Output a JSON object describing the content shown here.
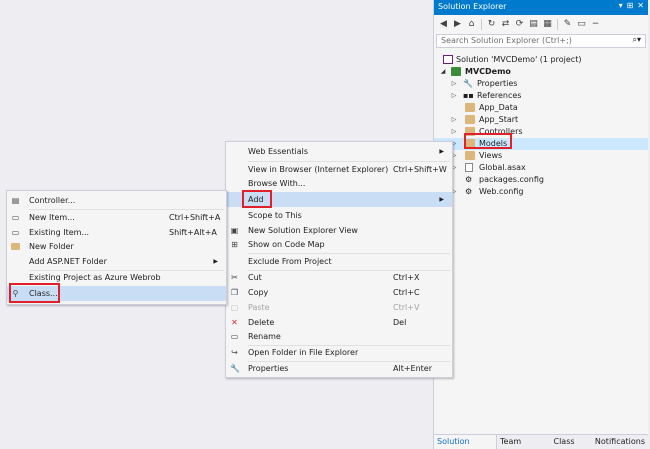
{
  "solution_explorer": {
    "title": "Solution Explorer",
    "title_buttons": [
      "▾",
      "⊞",
      "✕"
    ],
    "search_placeholder": "Search Solution Explorer (Ctrl+;)",
    "tree": [
      {
        "label": "Solution 'MVCDemo' (1 project)",
        "icon": "solution-icon"
      },
      {
        "label": "MVCDemo",
        "icon": "project-icon",
        "bold": true
      },
      {
        "label": "Properties",
        "icon": "wrench-icon"
      },
      {
        "label": "References",
        "icon": "references-icon"
      },
      {
        "label": "App_Data",
        "icon": "folder-icon"
      },
      {
        "label": "App_Start",
        "icon": "folder-icon"
      },
      {
        "label": "Controllers",
        "icon": "folder-icon"
      },
      {
        "label": "Models",
        "icon": "folder-icon"
      },
      {
        "label": "Views",
        "icon": "folder-icon"
      },
      {
        "label": "Global.asax",
        "icon": "file-icon"
      },
      {
        "label": "packages.config",
        "icon": "config-icon"
      },
      {
        "label": "Web.config",
        "icon": "config-icon"
      }
    ],
    "tabs": [
      "Solution Explor...",
      "Team Explorer",
      "Class View",
      "Notifications"
    ]
  },
  "context_menu": {
    "items": [
      {
        "label": "Web Essentials",
        "shortcut": "",
        "submenu": true
      },
      {
        "label": "View in Browser (Internet Explorer)",
        "shortcut": "Ctrl+Shift+W"
      },
      {
        "label": "Browse With...",
        "shortcut": ""
      },
      {
        "label": "Add",
        "shortcut": "",
        "submenu": true
      },
      {
        "label": "Scope to This",
        "shortcut": ""
      },
      {
        "label": "New Solution Explorer View",
        "shortcut": ""
      },
      {
        "label": "Show on Code Map",
        "shortcut": ""
      },
      {
        "label": "Exclude From Project",
        "shortcut": ""
      },
      {
        "label": "Cut",
        "shortcut": "Ctrl+X"
      },
      {
        "label": "Copy",
        "shortcut": "Ctrl+C"
      },
      {
        "label": "Paste",
        "shortcut": "Ctrl+V"
      },
      {
        "label": "Delete",
        "shortcut": "Del"
      },
      {
        "label": "Rename",
        "shortcut": ""
      },
      {
        "label": "Open Folder in File Explorer",
        "shortcut": ""
      },
      {
        "label": "Properties",
        "shortcut": "Alt+Enter"
      }
    ]
  },
  "add_menu": {
    "items": [
      {
        "label": "Controller...",
        "shortcut": ""
      },
      {
        "label": "New Item...",
        "shortcut": "Ctrl+Shift+A"
      },
      {
        "label": "Existing Item...",
        "shortcut": "Shift+Alt+A"
      },
      {
        "label": "New Folder",
        "shortcut": ""
      },
      {
        "label": "Add ASP.NET Folder",
        "shortcut": ""
      },
      {
        "label": "Existing Project as Azure Webrob",
        "shortcut": ""
      },
      {
        "label": "Class...",
        "shortcut": ""
      }
    ]
  },
  "colors": {
    "accent": "#007acc",
    "highlight_box": "#e0202a",
    "menu_highlight": "#c9def5"
  }
}
